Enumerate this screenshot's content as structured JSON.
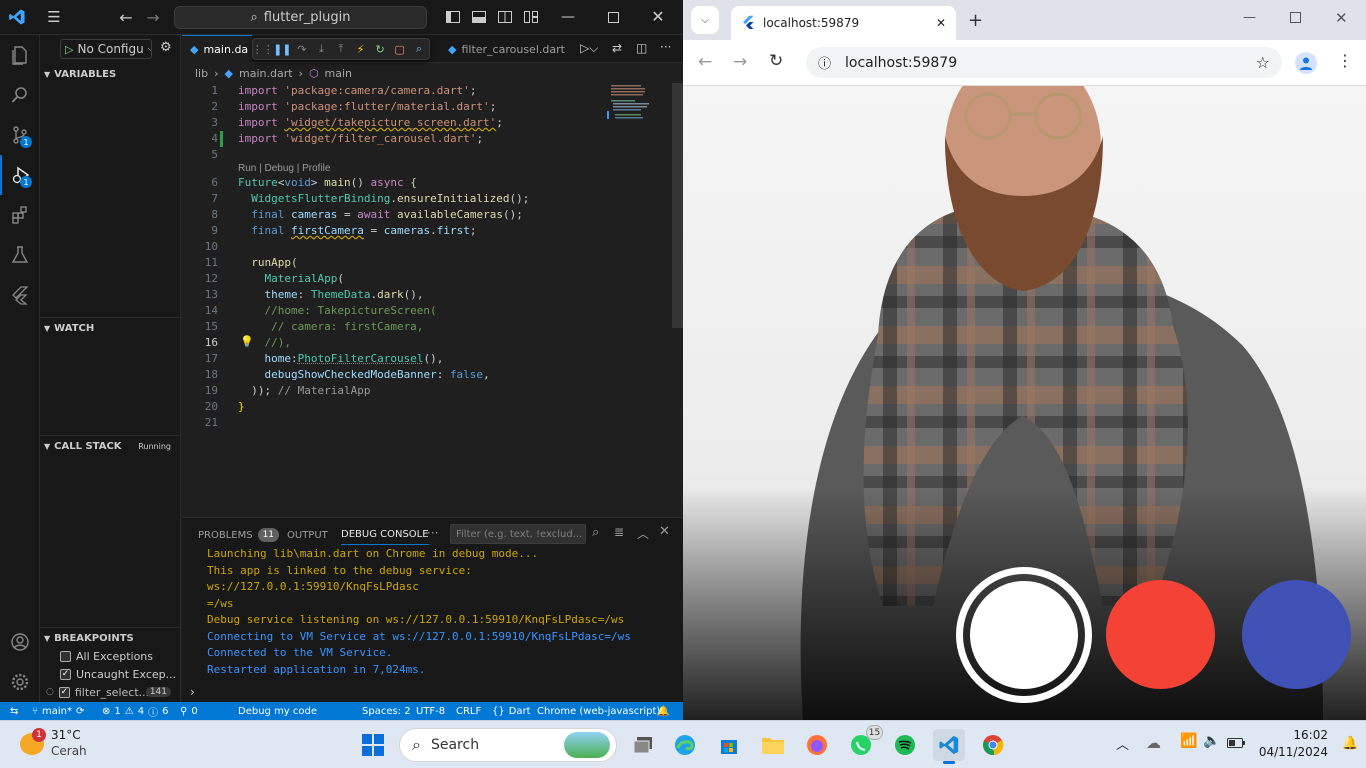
{
  "vscode": {
    "search_text": "flutter_plugin",
    "run_config": "No Configu",
    "sections": {
      "variables": "VARIABLES",
      "watch": "WATCH",
      "call_stack": "CALL STACK",
      "call_stack_state": "Running",
      "breakpoints": "BREAKPOINTS"
    },
    "breakpoints": [
      {
        "label": "All Exceptions",
        "checked": false
      },
      {
        "label": "Uncaught Excep...",
        "checked": true
      },
      {
        "label": "filter_select...",
        "checked": true,
        "count": "141"
      }
    ],
    "activity_badges": {
      "source_control": "1",
      "run_debug": "1"
    },
    "tabs": {
      "main": "main.da",
      "secondary": "filter_carousel.dart"
    },
    "breadcrumb": {
      "folder": "lib",
      "file": "main.dart",
      "symbol": "main"
    },
    "codelens": "Run | Debug | Profile",
    "code_lines": [
      {
        "n": "1",
        "text": "import 'package:camera/camera.dart';"
      },
      {
        "n": "2",
        "text": "import 'package:flutter/material.dart';"
      },
      {
        "n": "3",
        "text": "import 'widget/takepicture_screen.dart';"
      },
      {
        "n": "4",
        "text": "import 'widget/filter_carousel.dart';"
      },
      {
        "n": "5",
        "text": ""
      },
      {
        "n": "6",
        "text": "Future<void> main() async {"
      },
      {
        "n": "7",
        "text": "  WidgetsFlutterBinding.ensureInitialized();"
      },
      {
        "n": "8",
        "text": "  final cameras = await availableCameras();"
      },
      {
        "n": "9",
        "text": "  final firstCamera = cameras.first;"
      },
      {
        "n": "10",
        "text": ""
      },
      {
        "n": "11",
        "text": "  runApp("
      },
      {
        "n": "12",
        "text": "    MaterialApp("
      },
      {
        "n": "13",
        "text": "    theme: ThemeData.dark(),"
      },
      {
        "n": "14",
        "text": "    //home: TakepictureScreen("
      },
      {
        "n": "15",
        "text": "     // camera: firstCamera,"
      },
      {
        "n": "16",
        "text": "    //),"
      },
      {
        "n": "17",
        "text": "    home:PhotoFilterCarousel(),"
      },
      {
        "n": "18",
        "text": "    debugShowCheckedModeBanner: false,"
      },
      {
        "n": "19",
        "text": "  )); // MaterialApp"
      },
      {
        "n": "20",
        "text": "}"
      },
      {
        "n": "21",
        "text": ""
      }
    ],
    "panel": {
      "tabs": [
        "PROBLEMS",
        "OUTPUT",
        "DEBUG CONSOLE"
      ],
      "problems_count": "11",
      "filter_placeholder": "Filter (e.g. text, !exclud...",
      "console_lines": [
        {
          "text": "Launching lib\\main.dart on Chrome in debug mode...",
          "color": "yellow"
        },
        {
          "text": "This app is linked to the debug service: ws://127.0.0.1:59910/KnqFsLPdasc",
          "color": "yellow"
        },
        {
          "text": "=/ws",
          "color": "yellow"
        },
        {
          "text": "Debug service listening on ws://127.0.0.1:59910/KnqFsLPdasc=/ws",
          "color": "yellow"
        },
        {
          "text": "Connecting to VM Service at ws://127.0.0.1:59910/KnqFsLPdasc=/ws",
          "color": "blue"
        },
        {
          "text": "Connected to the VM Service.",
          "color": "blue"
        },
        {
          "text": "Restarted application in 7,024ms.",
          "color": "blue"
        }
      ]
    },
    "statusbar": {
      "branch": "main*",
      "errors": "1",
      "warnings": "4",
      "infos": "6",
      "ports": "0",
      "debug": "Debug my code",
      "spaces": "Spaces: 2",
      "encoding": "UTF-8",
      "eol": "CRLF",
      "language": "Dart",
      "device": "Chrome (web-javascript)"
    }
  },
  "chrome": {
    "tab_title": "localhost:59879",
    "url": "localhost:59879",
    "filter_buttons": [
      {
        "name": "white",
        "color": "#ffffff"
      },
      {
        "name": "red",
        "color": "#f44336"
      },
      {
        "name": "indigo",
        "color": "#3f51b5"
      }
    ]
  },
  "taskbar": {
    "weather_temp": "31°C",
    "weather_desc": "Cerah",
    "weather_badge": "1",
    "search_label": "Search",
    "whatsapp_badge": "15",
    "time": "16:02",
    "date": "04/11/2024"
  },
  "colors": {
    "vscode_accent": "#0078d4",
    "chrome_bg": "#dfe3e9",
    "taskbar_bg": "#dfe8f2"
  }
}
